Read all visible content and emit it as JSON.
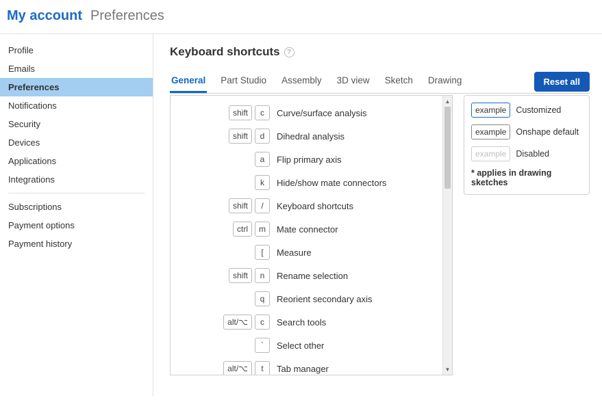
{
  "header": {
    "title": "My account",
    "section": "Preferences"
  },
  "sidebar": {
    "group1": [
      {
        "label": "Profile"
      },
      {
        "label": "Emails"
      },
      {
        "label": "Preferences",
        "active": true
      },
      {
        "label": "Notifications"
      },
      {
        "label": "Security"
      },
      {
        "label": "Devices"
      },
      {
        "label": "Applications"
      },
      {
        "label": "Integrations"
      }
    ],
    "group2": [
      {
        "label": "Subscriptions"
      },
      {
        "label": "Payment options"
      },
      {
        "label": "Payment history"
      }
    ]
  },
  "main": {
    "section_title": "Keyboard shortcuts",
    "help_glyph": "?",
    "tabs": [
      {
        "label": "General",
        "active": true
      },
      {
        "label": "Part Studio"
      },
      {
        "label": "Assembly"
      },
      {
        "label": "3D view"
      },
      {
        "label": "Sketch"
      },
      {
        "label": "Drawing"
      }
    ],
    "reset_label": "Reset all",
    "shortcuts": [
      {
        "keys": [
          "shift",
          "c"
        ],
        "action": "Curve/surface analysis"
      },
      {
        "keys": [
          "shift",
          "d"
        ],
        "action": "Dihedral analysis"
      },
      {
        "keys": [
          "a"
        ],
        "action": "Flip primary axis"
      },
      {
        "keys": [
          "k"
        ],
        "action": "Hide/show mate connectors"
      },
      {
        "keys": [
          "shift",
          "/"
        ],
        "action": "Keyboard shortcuts"
      },
      {
        "keys": [
          "ctrl",
          "m"
        ],
        "action": "Mate connector"
      },
      {
        "keys": [
          "["
        ],
        "action": "Measure"
      },
      {
        "keys": [
          "shift",
          "n"
        ],
        "action": "Rename selection"
      },
      {
        "keys": [
          "q"
        ],
        "action": "Reorient secondary axis"
      },
      {
        "keys": [
          "alt/⌥",
          "c"
        ],
        "action": "Search tools"
      },
      {
        "keys": [
          "`"
        ],
        "action": "Select other"
      },
      {
        "keys": [
          "alt/⌥",
          "t"
        ],
        "action": "Tab manager"
      }
    ],
    "legend": {
      "example_word": "example",
      "customized": "Customized",
      "default": "Onshape default",
      "disabled": "Disabled",
      "note": "* applies in drawing sketches"
    },
    "scroll_up_glyph": "▲",
    "scroll_down_glyph": "▼"
  }
}
